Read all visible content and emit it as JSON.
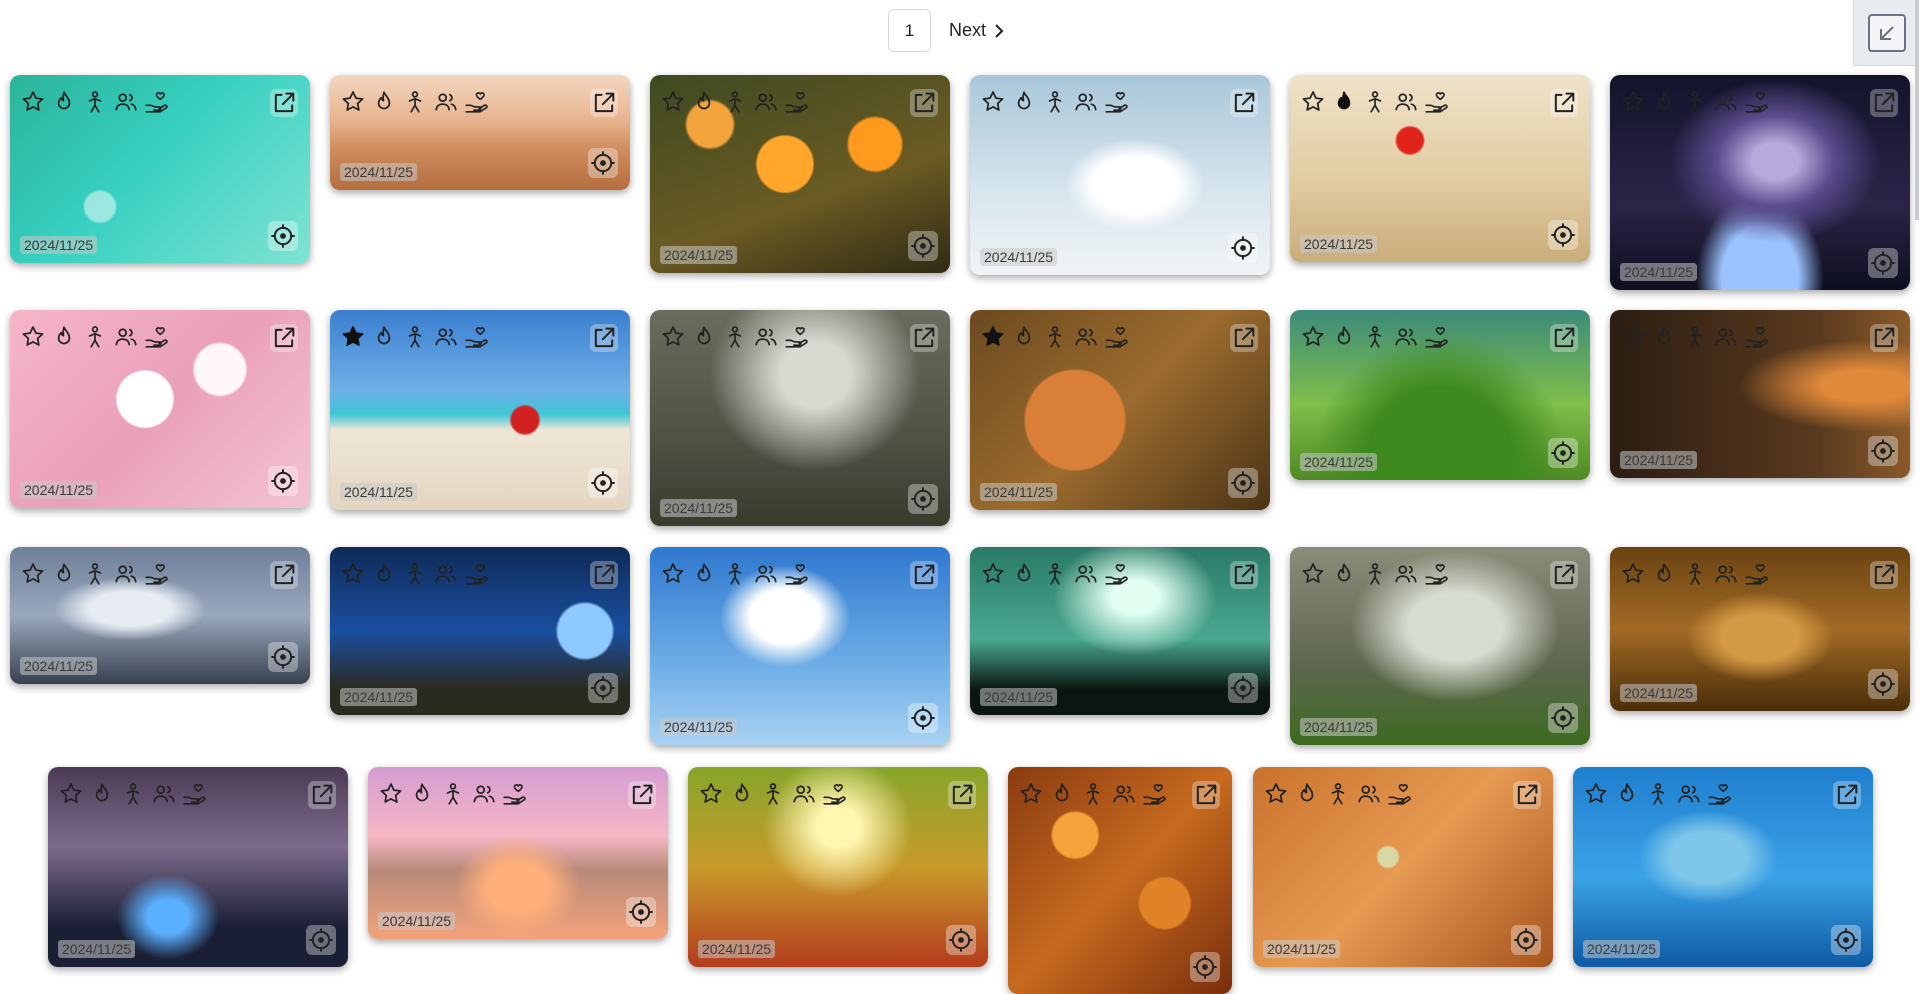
{
  "pagination": {
    "current_page": "1",
    "next_label": "Next"
  },
  "icon_set": [
    "star-icon",
    "flame-icon",
    "person-icon",
    "people-icon",
    "hand-heart-icon",
    "open-external-icon",
    "locate-icon"
  ],
  "cards": [
    {
      "id": "droplets",
      "date": "2024/11/25",
      "starred": false,
      "flame": false
    },
    {
      "id": "desert",
      "date": "2024/11/25",
      "starred": false,
      "flame": false
    },
    {
      "id": "orange-flowers",
      "date": "2024/11/25",
      "starred": false,
      "flame": false
    },
    {
      "id": "dove",
      "date": "2024/11/25",
      "starred": false,
      "flame": false
    },
    {
      "id": "poppy",
      "date": "2024/11/25",
      "starred": false,
      "flame": true
    },
    {
      "id": "galaxy",
      "date": "2024/11/25",
      "starred": false,
      "flame": false
    },
    {
      "id": "cherry-blossom",
      "date": "2024/11/25",
      "starred": false,
      "flame": false
    },
    {
      "id": "beach-drink",
      "date": "2024/11/25",
      "starred": true,
      "flame": false
    },
    {
      "id": "forest-sunrays",
      "date": "2024/11/25",
      "starred": false,
      "flame": false
    },
    {
      "id": "fox",
      "date": "2024/11/25",
      "starred": true,
      "flame": false
    },
    {
      "id": "green-field",
      "date": "2024/11/25",
      "starred": false,
      "flame": false
    },
    {
      "id": "dark-forest",
      "date": "2024/11/25",
      "starred": false,
      "flame": false
    },
    {
      "id": "pegasus",
      "date": "2024/11/25",
      "starred": false,
      "flame": false
    },
    {
      "id": "butterflies",
      "date": "2024/11/25",
      "starred": false,
      "flame": false
    },
    {
      "id": "clouds",
      "date": "2024/11/25",
      "starred": false,
      "flame": false
    },
    {
      "id": "crosses",
      "date": "2024/11/25",
      "starred": false,
      "flame": false
    },
    {
      "id": "trees",
      "date": "2024/11/25",
      "starred": false,
      "flame": false
    },
    {
      "id": "water-drop",
      "date": "2024/11/25",
      "starred": false,
      "flame": false
    },
    {
      "id": "city-fog",
      "date": "2024/11/25",
      "starred": false,
      "flame": false
    },
    {
      "id": "lake-church",
      "date": "2024/11/25",
      "starred": false,
      "flame": false
    },
    {
      "id": "autumn-forest",
      "date": "2024/11/25",
      "starred": false,
      "flame": false
    },
    {
      "id": "autumn-leaves",
      "date": "",
      "starred": false,
      "flame": false
    },
    {
      "id": "cat",
      "date": "2024/11/25",
      "starred": false,
      "flame": false
    },
    {
      "id": "dolphin",
      "date": "2024/11/25",
      "starred": false,
      "flame": false
    }
  ],
  "accent_colors": {
    "star_filled": "#111111",
    "icon_stroke": "#222222"
  }
}
